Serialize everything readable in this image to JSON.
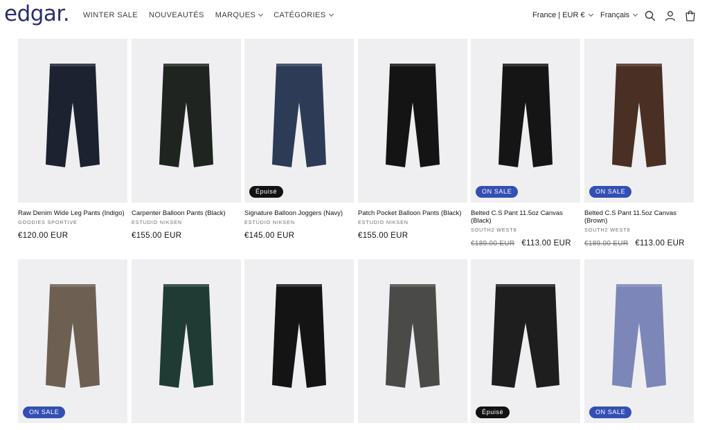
{
  "header": {
    "logo": "edgar.",
    "nav": [
      {
        "label": "WINTER SALE",
        "has_chevron": false
      },
      {
        "label": "NOUVEAUTÉS",
        "has_chevron": false
      },
      {
        "label": "MARQUES",
        "has_chevron": true
      },
      {
        "label": "CATÉGORIES",
        "has_chevron": true
      }
    ],
    "country_currency": "France | EUR €",
    "language": "Français",
    "icons": [
      "search-icon",
      "account-icon",
      "cart-icon"
    ]
  },
  "colors": {
    "logo": "#2c2c6e",
    "sale_badge": "#334fb4",
    "soldout_badge": "#121212",
    "image_bg": "#efeff1"
  },
  "products": [
    {
      "title": "Raw Denim Wide Leg Pants (Indigo)",
      "brand": "GOODIES SPORTIVE",
      "price": "€120.00 EUR",
      "old_price": "",
      "badge": "",
      "pant_color": "#1d2230"
    },
    {
      "title": "Carpenter Balloon Pants (Black)",
      "brand": "ESTUDIO NIKSEN",
      "price": "€155.00 EUR",
      "old_price": "",
      "badge": "",
      "pant_color": "#202421"
    },
    {
      "title": "Signature Balloon Joggers (Navy)",
      "brand": "ESTUDIO NIKSEN",
      "price": "€145.00 EUR",
      "old_price": "",
      "badge": "Épuisé",
      "pant_color": "#2d3b57"
    },
    {
      "title": "Patch Pocket Balloon Pants (Black)",
      "brand": "ESTUDIO NIKSEN",
      "price": "€155.00 EUR",
      "old_price": "",
      "badge": "",
      "pant_color": "#141414"
    },
    {
      "title": "Belted C.S Pant 11.5oz Canvas (Black)",
      "brand": "SOUTH2 WEST8",
      "price": "€113.00 EUR",
      "old_price": "€189.00 EUR",
      "badge": "ON SALE",
      "pant_color": "#151515"
    },
    {
      "title": "Belted C.S Pant 11.5oz Canvas (Brown)",
      "brand": "SOUTH2 WEST8",
      "price": "€113.00 EUR",
      "old_price": "€189.00 EUR",
      "badge": "ON SALE",
      "pant_color": "#4a2f24"
    },
    {
      "title": "",
      "brand": "",
      "price": "",
      "old_price": "",
      "badge": "ON SALE",
      "pant_color": "#6d6053"
    },
    {
      "title": "",
      "brand": "",
      "price": "",
      "old_price": "",
      "badge": "",
      "pant_color": "#1f3b33"
    },
    {
      "title": "",
      "brand": "",
      "price": "",
      "old_price": "",
      "badge": "",
      "pant_color": "#141414"
    },
    {
      "title": "",
      "brand": "",
      "price": "",
      "old_price": "",
      "badge": "",
      "pant_color": "#4a4a48"
    },
    {
      "title": "",
      "brand": "",
      "price": "",
      "old_price": "",
      "badge": "Épuisé",
      "pant_color": "#1e1e1e"
    },
    {
      "title": "",
      "brand": "",
      "price": "",
      "old_price": "",
      "badge": "ON SALE",
      "pant_color": "#7d86b8"
    }
  ]
}
